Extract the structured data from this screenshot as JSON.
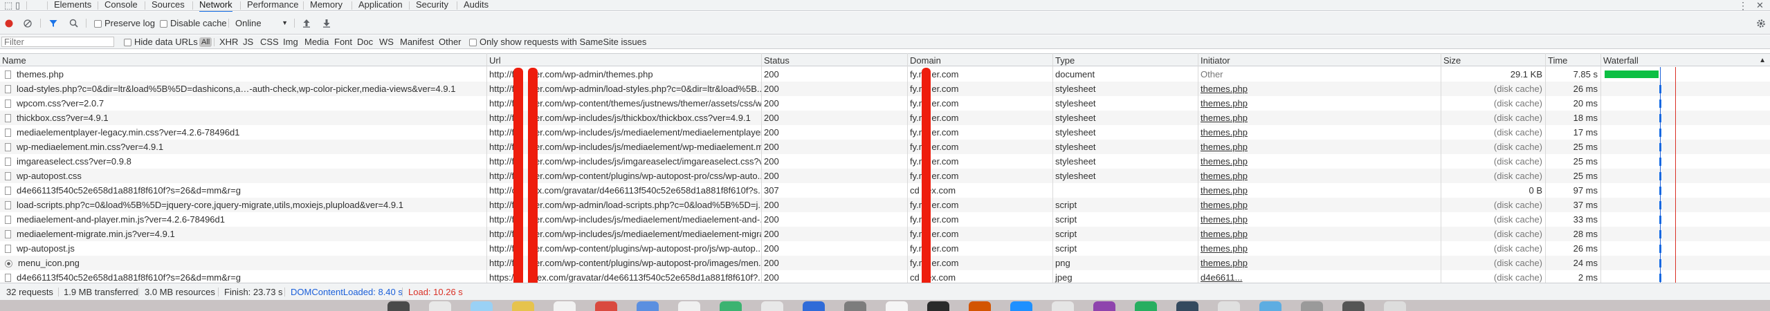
{
  "tabbar": {
    "tabs": [
      "Elements",
      "Console",
      "Sources",
      "Network",
      "Performance",
      "Memory",
      "Application",
      "Security",
      "Audits"
    ],
    "active": "Network",
    "left_icons": [
      "inspect-icon",
      "device-toggle-icon"
    ],
    "right_icons": [
      "more-vertical-icon",
      "close-icon"
    ]
  },
  "toolbar": {
    "preserve_log": "Preserve log",
    "disable_cache": "Disable cache",
    "throttle": "Online",
    "icons": [
      "record-icon",
      "clear-icon",
      "filter-icon",
      "search-icon",
      "import-icon",
      "export-icon",
      "settings-icon"
    ]
  },
  "filterbar": {
    "placeholder": "Filter",
    "hide_data_urls": "Hide data URLs",
    "types": [
      "All",
      "XHR",
      "JS",
      "CSS",
      "Img",
      "Media",
      "Font",
      "Doc",
      "WS",
      "Manifest",
      "Other"
    ],
    "samesite": "Only show requests with SameSite issues"
  },
  "table": {
    "headers": {
      "name": "Name",
      "url": "Url",
      "status": "Status",
      "domain": "Domain",
      "type": "Type",
      "initiator": "Initiator",
      "size": "Size",
      "time": "Time",
      "waterfall": "Waterfall"
    },
    "rows": [
      {
        "name": "themes.php",
        "url": "http://fy         er.com/wp-admin/themes.php",
        "status": "200",
        "domain": "fy.m   er.com",
        "type": "document",
        "initiator": "Other",
        "size": "29.1 KB",
        "time": "7.85 s"
      },
      {
        "name": "load-styles.php?c=0&dir=ltr&load%5B%5D=dashicons,a…-auth-check,wp-color-picker,media-views&ver=4.9.1",
        "url": "http://fy         er.com/wp-admin/load-styles.php?c=0&dir=ltr&load%5B...",
        "status": "200",
        "domain": "fy.m   er.com",
        "type": "stylesheet",
        "initiator": "themes.php",
        "size": "(disk cache)",
        "time": "26 ms"
      },
      {
        "name": "wpcom.css?ver=2.0.7",
        "url": "http://fy         er.com/wp-content/themes/justnews/themer/assets/css/w...",
        "status": "200",
        "domain": "fy.m   er.com",
        "type": "stylesheet",
        "initiator": "themes.php",
        "size": "(disk cache)",
        "time": "20 ms"
      },
      {
        "name": "thickbox.css?ver=4.9.1",
        "url": "http://fy         er.com/wp-includes/js/thickbox/thickbox.css?ver=4.9.1",
        "status": "200",
        "domain": "fy.m   er.com",
        "type": "stylesheet",
        "initiator": "themes.php",
        "size": "(disk cache)",
        "time": "18 ms"
      },
      {
        "name": "mediaelementplayer-legacy.min.css?ver=4.2.6-78496d1",
        "url": "http://fy         er.com/wp-includes/js/mediaelement/mediaelementplayer...",
        "status": "200",
        "domain": "fy.m   er.com",
        "type": "stylesheet",
        "initiator": "themes.php",
        "size": "(disk cache)",
        "time": "17 ms"
      },
      {
        "name": "wp-mediaelement.min.css?ver=4.9.1",
        "url": "http://fy         er.com/wp-includes/js/mediaelement/wp-mediaelement.m...",
        "status": "200",
        "domain": "fy.m   er.com",
        "type": "stylesheet",
        "initiator": "themes.php",
        "size": "(disk cache)",
        "time": "25 ms"
      },
      {
        "name": "imgareaselect.css?ver=0.9.8",
        "url": "http://fy         er.com/wp-includes/js/imgareaselect/imgareaselect.css?v...",
        "status": "200",
        "domain": "fy.m   er.com",
        "type": "stylesheet",
        "initiator": "themes.php",
        "size": "(disk cache)",
        "time": "25 ms"
      },
      {
        "name": "wp-autopost.css",
        "url": "http://fy         er.com/wp-content/plugins/wp-autopost-pro/css/wp-auto...",
        "status": "200",
        "domain": "fy.m   er.com",
        "type": "stylesheet",
        "initiator": "themes.php",
        "size": "(disk cache)",
        "time": "25 ms"
      },
      {
        "name": "d4e66113f540c52e658d1a881f8f610f?s=26&d=mm&r=g",
        "url": "http://c         ex.com/gravatar/d4e66113f540c52e658d1a881f8f610f?s...",
        "status": "307",
        "domain": "cd    ex.com",
        "type": "",
        "initiator": "themes.php",
        "size": "0 B",
        "time": "97 ms"
      },
      {
        "name": "load-scripts.php?c=0&load%5B%5D=jquery-core,jquery-migrate,utils,moxiejs,plupload&ver=4.9.1",
        "url": "http://fy         er.com/wp-admin/load-scripts.php?c=0&load%5B%5D=j...",
        "status": "200",
        "domain": "fy.m   er.com",
        "type": "script",
        "initiator": "themes.php",
        "size": "(disk cache)",
        "time": "37 ms"
      },
      {
        "name": "mediaelement-and-player.min.js?ver=4.2.6-78496d1",
        "url": "http://fy         er.com/wp-includes/js/mediaelement/mediaelement-and-...",
        "status": "200",
        "domain": "fy.m   er.com",
        "type": "script",
        "initiator": "themes.php",
        "size": "(disk cache)",
        "time": "33 ms"
      },
      {
        "name": "mediaelement-migrate.min.js?ver=4.9.1",
        "url": "http://fy         er.com/wp-includes/js/mediaelement/mediaelement-migra...",
        "status": "200",
        "domain": "fy.m   er.com",
        "type": "script",
        "initiator": "themes.php",
        "size": "(disk cache)",
        "time": "28 ms"
      },
      {
        "name": "wp-autopost.js",
        "url": "http://fy         er.com/wp-content/plugins/wp-autopost-pro/js/wp-autop...",
        "status": "200",
        "domain": "fy.m   er.com",
        "type": "script",
        "initiator": "themes.php",
        "size": "(disk cache)",
        "time": "26 ms"
      },
      {
        "name": "menu_icon.png",
        "url": "http://fy         er.com/wp-content/plugins/wp-autopost-pro/images/men...",
        "status": "200",
        "domain": "fy.m   er.com",
        "type": "png",
        "initiator": "themes.php",
        "size": "(disk cache)",
        "time": "24 ms"
      },
      {
        "name": "d4e66113f540c52e658d1a881f8f610f?s=26&d=mm&r=g",
        "url": "https://c         ex.com/gravatar/d4e66113f540c52e658d1a881f8f610f?...",
        "status": "200",
        "domain": "cd    ex.com",
        "type": "jpeg",
        "initiator": "d4e6611...",
        "size": "(disk cache)",
        "time": "2 ms"
      }
    ]
  },
  "statusbar": {
    "requests": "32 requests",
    "transferred": "1.9 MB transferred",
    "resources": "3.0 MB resources",
    "finish": "Finish: 23.73 s",
    "dcl": "DOMContentLoaded: 8.40 s",
    "load": "Load: 10.26 s"
  },
  "colors": {
    "accent": "#1a73e8",
    "dcl": "#1a5fd9",
    "load": "#d93025",
    "waterfall_green": "#0cbf43",
    "redaction": "#ee1d0d",
    "record": "#d93025"
  }
}
